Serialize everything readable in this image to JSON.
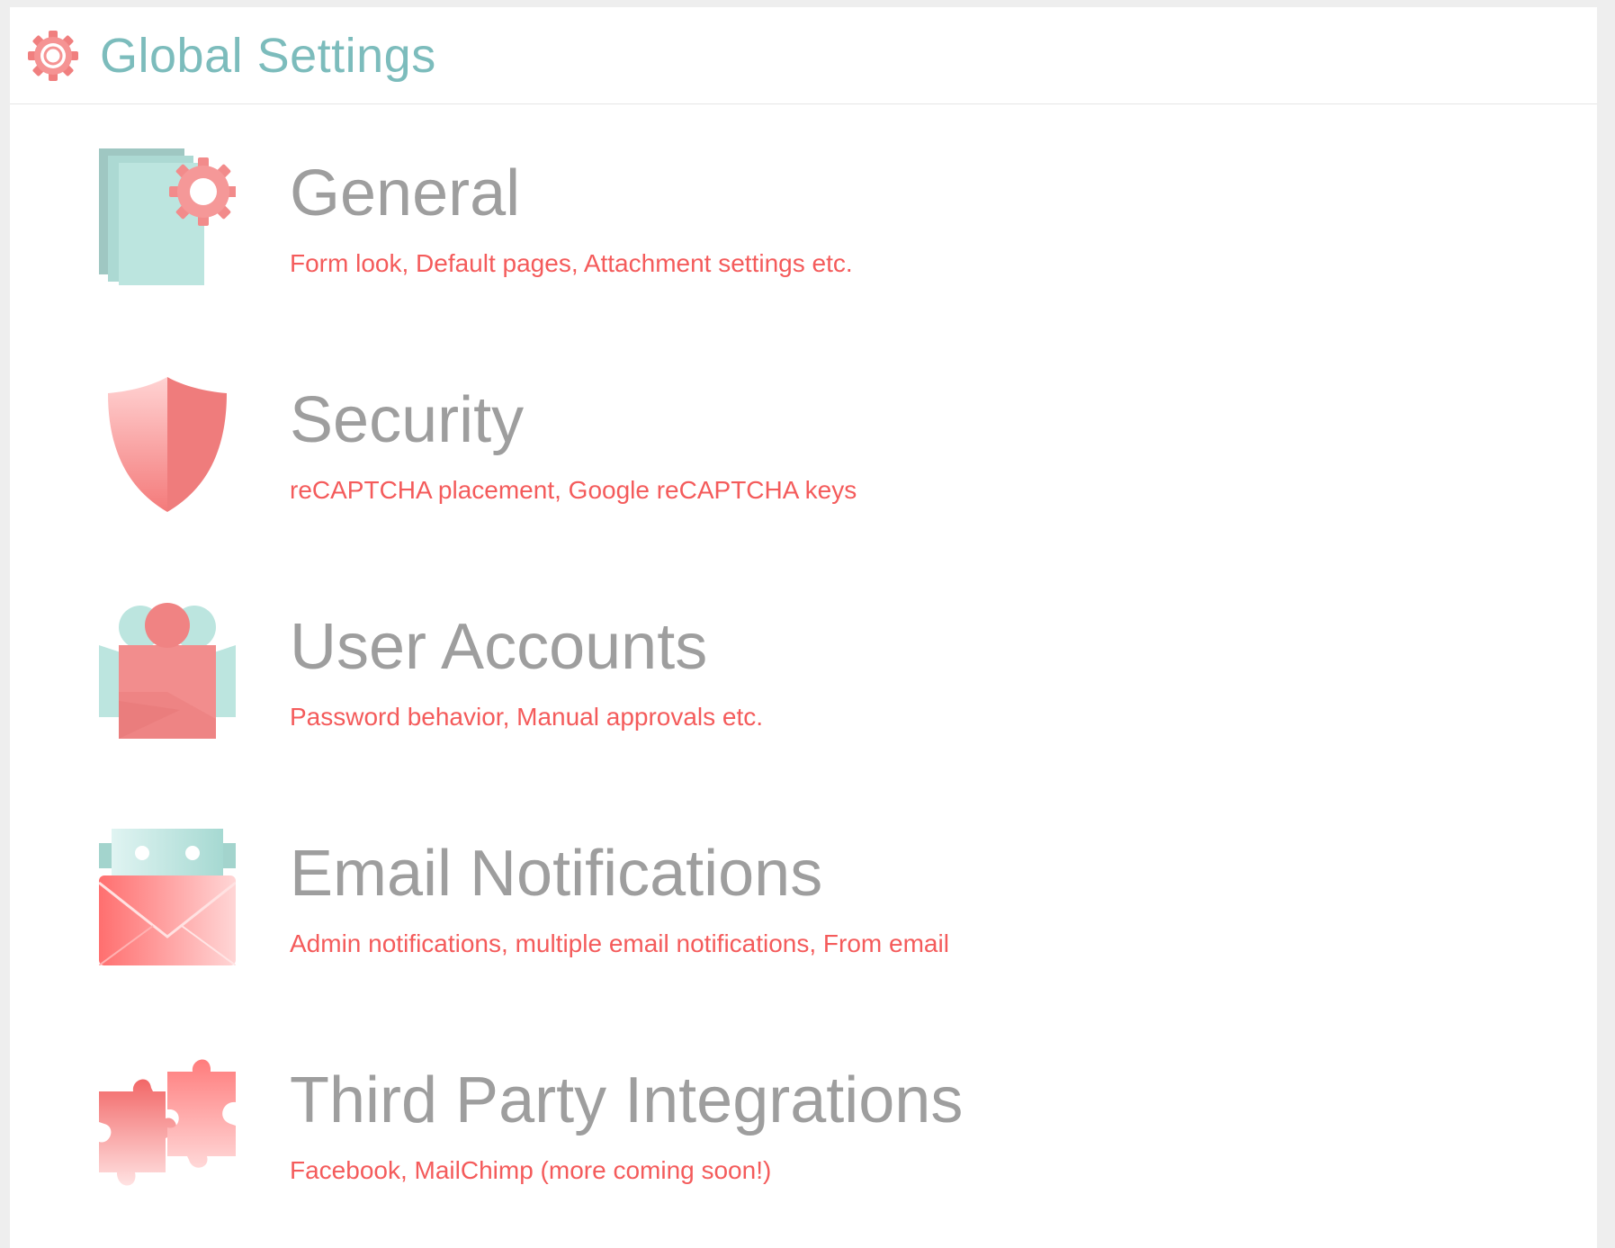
{
  "header": {
    "title": "Global Settings",
    "icon": "gear-icon"
  },
  "colors": {
    "title_teal": "#7cbcbc",
    "item_title_gray": "#9e9e9e",
    "desc_red": "#f45b5b",
    "icon_teal": "#b8e2dd",
    "icon_pink": "#f28b8b"
  },
  "items": [
    {
      "id": "general",
      "title": "General",
      "description": "Form look, Default pages, Attachment settings etc.",
      "icon": "documents-gear-icon"
    },
    {
      "id": "security",
      "title": "Security",
      "description": "reCAPTCHA placement, Google reCAPTCHA keys",
      "icon": "shield-icon"
    },
    {
      "id": "user-accounts",
      "title": "User Accounts",
      "description": "Password behavior, Manual approvals etc.",
      "icon": "users-icon"
    },
    {
      "id": "email-notifications",
      "title": "Email Notifications",
      "description": "Admin notifications, multiple email notifications, From email",
      "icon": "envelope-icon"
    },
    {
      "id": "third-party-integrations",
      "title": "Third Party Integrations",
      "description": "Facebook, MailChimp (more coming soon!)",
      "icon": "puzzle-icon"
    }
  ]
}
